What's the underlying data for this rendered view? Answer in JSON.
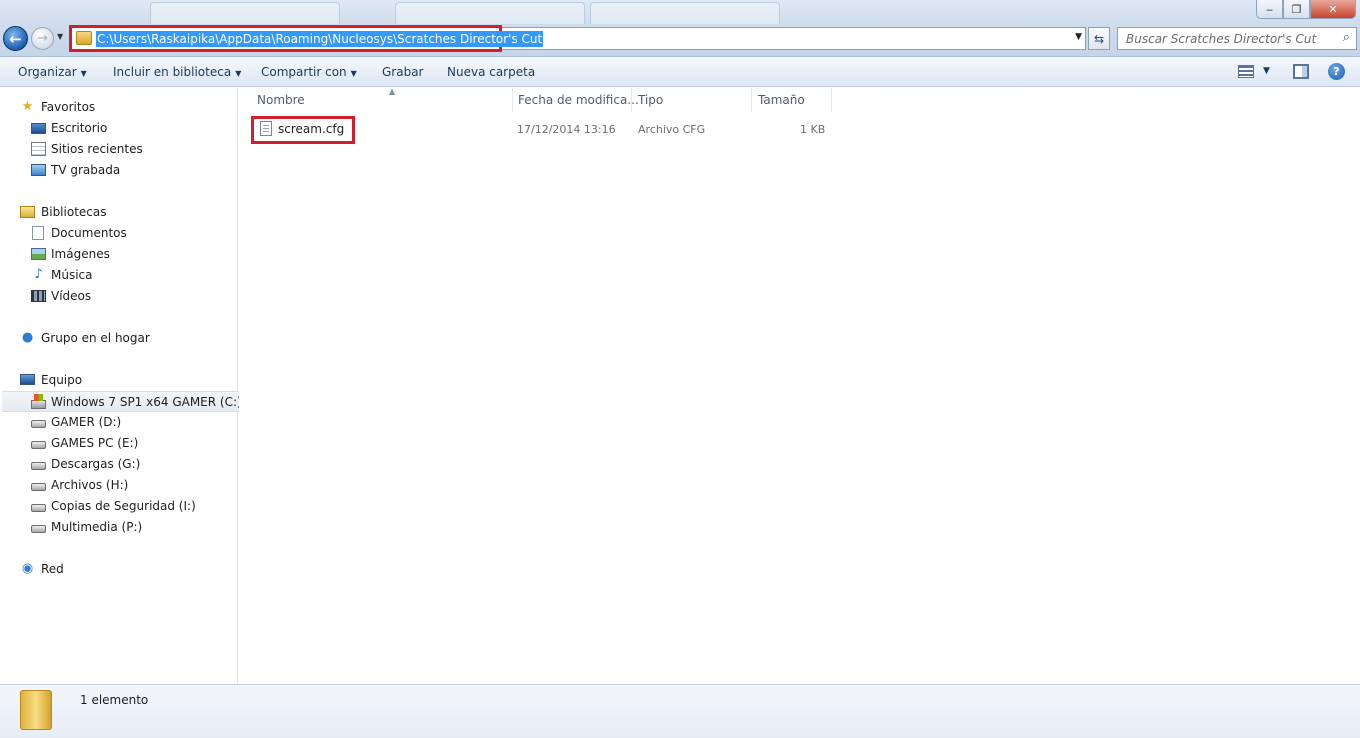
{
  "window": {
    "minimize": "‒",
    "maximize": "❐",
    "close": "✕"
  },
  "navigation": {
    "address_path": "C:\\Users\\Raskaipika\\AppData\\Roaming\\Nucleosys\\Scratches Director's Cut",
    "search_placeholder": "Buscar Scratches Director's Cut"
  },
  "toolbar": {
    "organize": "Organizar",
    "include_library": "Incluir en biblioteca",
    "share_with": "Compartir con",
    "burn": "Grabar",
    "new_folder": "Nueva carpeta"
  },
  "sidebar": {
    "favorites": {
      "label": "Favoritos",
      "items": [
        "Escritorio",
        "Sitios recientes",
        "TV grabada"
      ]
    },
    "libraries": {
      "label": "Bibliotecas",
      "items": [
        "Documentos",
        "Imágenes",
        "Música",
        "Vídeos"
      ]
    },
    "homegroup": "Grupo en el hogar",
    "computer": {
      "label": "Equipo",
      "items": [
        "Windows 7 SP1 x64 GAMER (C:)",
        "GAMER (D:)",
        "GAMES PC (E:)",
        "Descargas (G:)",
        "Archivos (H:)",
        "Copias de Seguridad (I:)",
        "Multimedia (P:)"
      ]
    },
    "network": "Red"
  },
  "columns": {
    "name": "Nombre",
    "date": "Fecha de modifica...",
    "type": "Tipo",
    "size": "Tamaño"
  },
  "files": [
    {
      "name": "scream.cfg",
      "date": "17/12/2014 13:16",
      "type": "Archivo CFG",
      "size": "1 KB"
    }
  ],
  "status": {
    "item_count": "1 elemento"
  },
  "colors": {
    "highlight_box": "#d11f2e",
    "selection_blue": "#3399ff"
  }
}
